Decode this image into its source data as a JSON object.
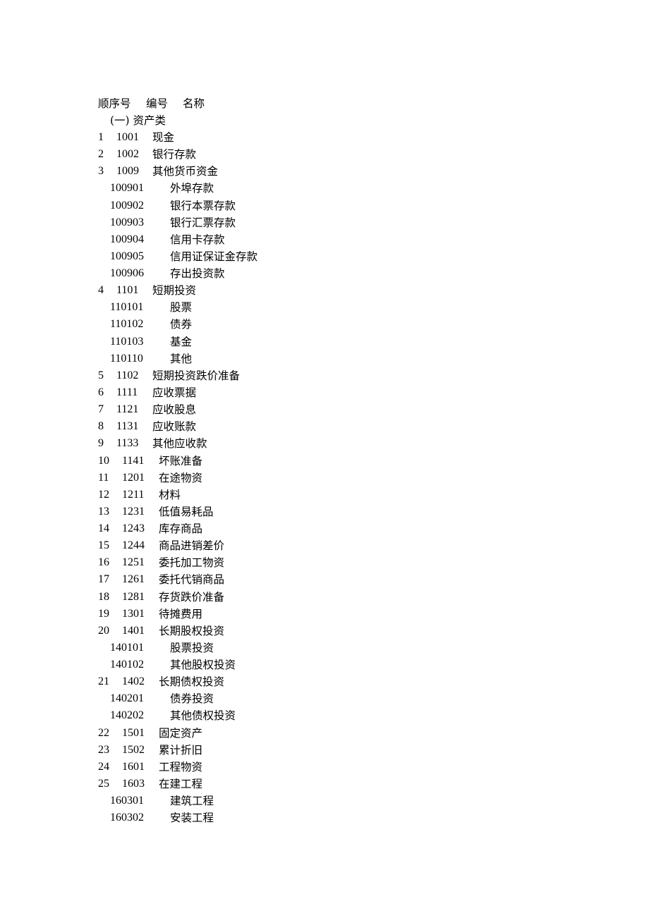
{
  "header": {
    "seq": "顺序号",
    "code": "编号",
    "name": "名称"
  },
  "section": {
    "label": "(一) 资产类"
  },
  "rows": [
    {
      "type": "main",
      "seq": "1",
      "code": "1001",
      "name": "现金"
    },
    {
      "type": "main",
      "seq": "2",
      "code": "1002",
      "name": "银行存款"
    },
    {
      "type": "main",
      "seq": "3",
      "code": "1009",
      "name": "其他货币资金"
    },
    {
      "type": "sub",
      "code": "100901",
      "name": "外埠存款"
    },
    {
      "type": "sub",
      "code": "100902",
      "name": "银行本票存款"
    },
    {
      "type": "sub",
      "code": "100903",
      "name": "银行汇票存款"
    },
    {
      "type": "sub",
      "code": "100904",
      "name": "信用卡存款"
    },
    {
      "type": "sub",
      "code": "100905",
      "name": "信用证保证金存款"
    },
    {
      "type": "sub",
      "code": "100906",
      "name": "存出投资款"
    },
    {
      "type": "main",
      "seq": "4",
      "code": "1101",
      "name": "短期投资"
    },
    {
      "type": "sub",
      "code": "110101",
      "name": "股票"
    },
    {
      "type": "sub",
      "code": "110102",
      "name": "债券"
    },
    {
      "type": "sub",
      "code": "110103",
      "name": "基金"
    },
    {
      "type": "sub",
      "code": "110110",
      "name": "其他"
    },
    {
      "type": "main",
      "seq": "5",
      "code": "1102",
      "name": "短期投资跌价准备"
    },
    {
      "type": "main",
      "seq": "6",
      "code": "1111",
      "name": "应收票据"
    },
    {
      "type": "main",
      "seq": "7",
      "code": "1121",
      "name": "应收股息"
    },
    {
      "type": "main",
      "seq": "8",
      "code": "1131",
      "name": "应收账款"
    },
    {
      "type": "main",
      "seq": "9",
      "code": "1133",
      "name": "其他应收款"
    },
    {
      "type": "main2",
      "seq": "10",
      "code": "1141",
      "name": "坏账准备"
    },
    {
      "type": "main2",
      "seq": "11",
      "code": "1201",
      "name": "在途物资"
    },
    {
      "type": "main2",
      "seq": "12",
      "code": "1211",
      "name": "材料"
    },
    {
      "type": "main2",
      "seq": "13",
      "code": "1231",
      "name": "低值易耗品"
    },
    {
      "type": "main2",
      "seq": "14",
      "code": "1243",
      "name": "库存商品"
    },
    {
      "type": "main2",
      "seq": "15",
      "code": "1244",
      "name": "商品进销差价"
    },
    {
      "type": "main2",
      "seq": "16",
      "code": "1251",
      "name": "委托加工物资"
    },
    {
      "type": "main2",
      "seq": "17",
      "code": "1261",
      "name": "委托代销商品"
    },
    {
      "type": "main2",
      "seq": "18",
      "code": "1281",
      "name": "存货跌价准备"
    },
    {
      "type": "main2",
      "seq": "19",
      "code": "1301",
      "name": "待摊费用"
    },
    {
      "type": "main2",
      "seq": "20",
      "code": "1401",
      "name": "长期股权投资"
    },
    {
      "type": "sub",
      "code": "140101",
      "name": "股票投资"
    },
    {
      "type": "sub",
      "code": "140102",
      "name": "其他股权投资"
    },
    {
      "type": "main2",
      "seq": "21",
      "code": "1402",
      "name": "长期债权投资"
    },
    {
      "type": "sub",
      "code": "140201",
      "name": "债券投资"
    },
    {
      "type": "sub",
      "code": "140202",
      "name": "其他债权投资"
    },
    {
      "type": "main2",
      "seq": "22",
      "code": "1501",
      "name": "固定资产"
    },
    {
      "type": "main2",
      "seq": "23",
      "code": "1502",
      "name": "累计折旧"
    },
    {
      "type": "main2",
      "seq": "24",
      "code": "1601",
      "name": "工程物资"
    },
    {
      "type": "main2",
      "seq": "25",
      "code": "1603",
      "name": "在建工程"
    },
    {
      "type": "sub",
      "code": "160301",
      "name": "建筑工程"
    },
    {
      "type": "sub",
      "code": "160302",
      "name": "安装工程"
    }
  ]
}
